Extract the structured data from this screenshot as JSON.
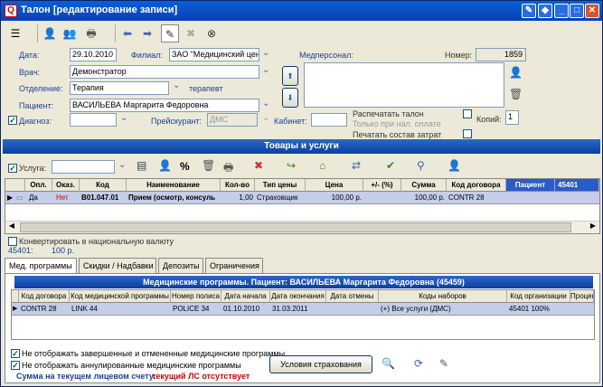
{
  "window": {
    "title": "Талон [редактирование записи]"
  },
  "form": {
    "date_label": "Дата:",
    "date_value": "29.10.2010",
    "branch_label": "Филиал:",
    "branch_value": "ЗАО \"Медицинский цент",
    "staff_label": "Медперсонал:",
    "number_label": "Номер:",
    "number_value": "1859",
    "doctor_label": "Врач:",
    "doctor_value": "Демонстратор",
    "department_label": "Отделение:",
    "department_value": "Терапия",
    "department_extra": "терапевт",
    "patient_label": "Пациент:",
    "patient_value": "ВАСИЛЬЕВА Маргарита Федоровна",
    "diagnosis_label": "Диагноз:",
    "pricelist_label": "Прейскурант:",
    "pricelist_value": "ДМС",
    "cabinet_label": "Кабинет:",
    "print_ticket": "Распечатать талон",
    "only_paid": "Только при нал. оплате",
    "print_costs": "Печатать состав затрат",
    "copies_label": "Копий:",
    "copies_value": "1"
  },
  "services": {
    "section_title": "Товары и услуги",
    "service_label": "Услуга:",
    "percent_sign": "%",
    "columns": [
      "Опл.",
      "Оказ.",
      "Код",
      "Наименование",
      "Кол-во",
      "Тип цены",
      "Цена",
      "+/- (%)",
      "Сумма",
      "Код договора",
      "Пациент",
      "45401"
    ],
    "rows": [
      {
        "paid": "Да",
        "done": "Нет",
        "code": "B01.047.01",
        "name": "Прием (осмотр, консуль",
        "qty": "1,00",
        "price_type": "Страховщик",
        "price": "100,00 р.",
        "pct": "",
        "sum": "100,00 р.",
        "contract": "CONTR 28",
        "patient": "",
        "extra": ""
      }
    ],
    "convert_label": "Конвертировать в национальную валюту",
    "total_label": "45401:",
    "total_value": "100 р."
  },
  "tabs": [
    "Мед. программы",
    "Скидки / Надбавки",
    "Депозиты",
    "Ограничения"
  ],
  "programs": {
    "title": "Медицинские программы. Пациент: ВАСИЛЬЕВА Маргарита Федоровна (45459)",
    "columns": [
      "Код договора",
      "Код медицинской программы",
      "Номер полиса",
      "Дата начала",
      "Дата окончания",
      "Дата отмены",
      "Коды наборов",
      "Код организации",
      "Процент"
    ],
    "rows": [
      {
        "contract": "CONTR 28",
        "program": "LINK 44",
        "policy": "POLICE 34",
        "start": "01.10.2010",
        "end": "31.03.2011",
        "cancel": "",
        "sets": "(+) Все услуги (ДМС)",
        "org": "45401 100%",
        "pct": ""
      }
    ],
    "hide_finished": "Не отображать завершенные и отмененные медицинские программы",
    "hide_cancelled": "Не отображать аннулированные медицинские программы",
    "balance_label": "Сумма на текущем лицевом счету:",
    "balance_value": "текущий ЛС отсутствует",
    "insurance_button": "Условия страхования"
  },
  "colors": {
    "titlebar": "#0842b0",
    "section": "#0b3f9e",
    "highlight": "#2a5bc8",
    "alert": "#cc0000"
  }
}
